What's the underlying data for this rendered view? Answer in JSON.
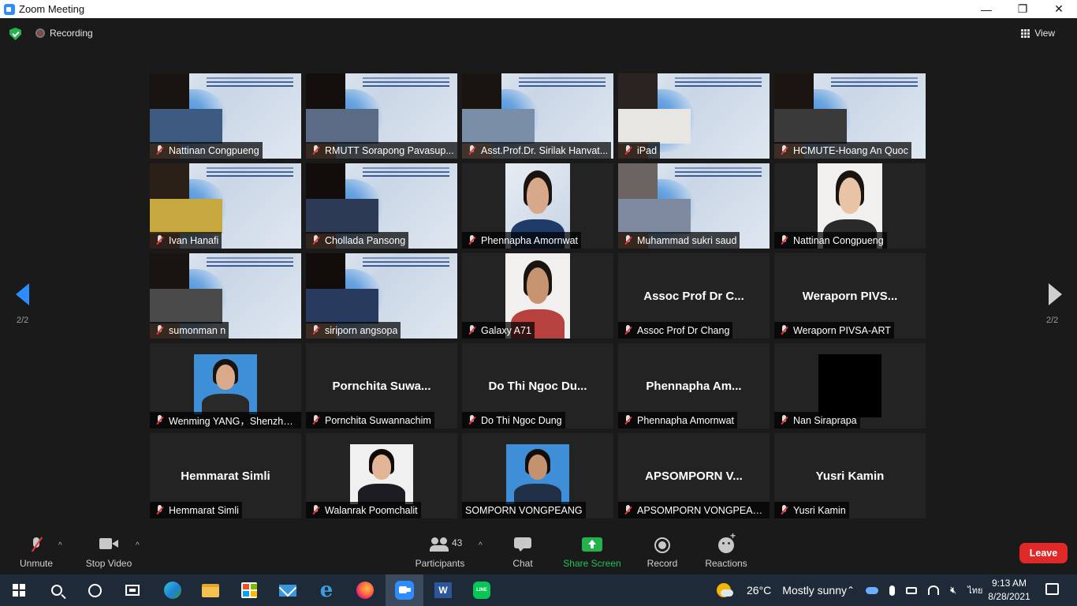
{
  "window": {
    "title": "Zoom Meeting",
    "minimize_glyph": "—",
    "maximize_glyph": "❐",
    "close_glyph": "✕"
  },
  "meeting": {
    "recording_label": "Recording",
    "view_label": "View",
    "page_indicator_left": "2/2",
    "page_indicator_right": "2/2"
  },
  "tiles": [
    {
      "label": "Nattinan Congpueng",
      "muted": true,
      "kind": "banner",
      "person": {
        "skin": "#c99a78",
        "hair": "#1a1410",
        "shirt": "#3d5a80"
      }
    },
    {
      "label": "RMUTT Sorapong Pavasup...",
      "muted": true,
      "kind": "banner",
      "person": {
        "skin": "#c9956f",
        "hair": "#140f0c",
        "shirt": "#5b6b86"
      }
    },
    {
      "label": "Asst.Prof.Dr. Sirilak Hanvat...",
      "muted": true,
      "kind": "banner",
      "person": {
        "skin": "#e5b89a",
        "hair": "#1a1410",
        "shirt": "#7a8ea8"
      }
    },
    {
      "label": "iPad",
      "muted": true,
      "kind": "banner",
      "person": {
        "skin": "#c79573",
        "hair": "#2a2320",
        "shirt": "#e8e6e2"
      }
    },
    {
      "label": "HCMUTE-Hoang An Quoc",
      "muted": true,
      "kind": "banner",
      "person": {
        "skin": "#d6a685",
        "hair": "#1c1410",
        "shirt": "#3b3a3a"
      }
    },
    {
      "label": "Ivan Hanafi",
      "muted": true,
      "kind": "banner",
      "person": {
        "skin": "#a8755a",
        "hair": "#2a2018",
        "shirt": "#c7a83e"
      }
    },
    {
      "label": "Chollada Pansong",
      "muted": true,
      "kind": "banner",
      "person": {
        "skin": "#b88466",
        "hair": "#120d0a",
        "shirt": "#2c3a55"
      }
    },
    {
      "label": "Phennapha Amornwat",
      "muted": true,
      "kind": "narrow-banner",
      "person": {
        "skin": "#d8a88a",
        "hair": "#1a1410",
        "shirt": "#1f3c68"
      }
    },
    {
      "label": "Muhammad sukri saud",
      "muted": true,
      "kind": "banner",
      "person": {
        "skin": "#c08b6d",
        "hair": "#6b6460",
        "shirt": "#7d8aa0"
      }
    },
    {
      "label": "Nattinan Congpueng",
      "muted": true,
      "kind": "portrait-white",
      "person": {
        "skin": "#e8c3a6",
        "hair": "#1a1410",
        "shirt": "#2a2a2a"
      }
    },
    {
      "label": "sumonman n",
      "muted": true,
      "kind": "banner",
      "person": {
        "skin": "#c38f70",
        "hair": "#1a1410",
        "shirt": "#4a4a4a"
      }
    },
    {
      "label": "siriporn angsopa",
      "muted": true,
      "kind": "banner",
      "person": {
        "skin": "#d3a283",
        "hair": "#120d0a",
        "shirt": "#283a5e"
      }
    },
    {
      "label": "Galaxy A71",
      "muted": true,
      "kind": "portrait-white",
      "person": {
        "skin": "#c79472",
        "hair": "#1a1410",
        "shirt": "#b7413f"
      }
    },
    {
      "label": "Assoc Prof Dr Chang",
      "muted": true,
      "kind": "name",
      "big_name": "Assoc Prof Dr C..."
    },
    {
      "label": "Weraporn PIVSA-ART",
      "muted": true,
      "kind": "name",
      "big_name": "Weraporn  PIVS..."
    },
    {
      "label": "Wenming YANG，Shenzhen...",
      "muted": true,
      "kind": "photo-blue",
      "person": {
        "skin": "#d9a98a",
        "hair": "#1a1410",
        "shirt": "#2a2a2a"
      }
    },
    {
      "label": "Pornchita Suwannachim",
      "muted": true,
      "kind": "name",
      "big_name": "Pornchita  Suwa..."
    },
    {
      "label": "Do Thi Ngoc Dung",
      "muted": true,
      "kind": "name",
      "big_name": "Do Thi Ngoc Du..."
    },
    {
      "label": "Phennapha Amornwat",
      "muted": true,
      "kind": "name",
      "big_name": "Phennapha  Am..."
    },
    {
      "label": "Nan Siraprapa",
      "muted": true,
      "kind": "black"
    },
    {
      "label": "Hemmarat Simli",
      "muted": true,
      "kind": "name",
      "big_name": "Hemmarat Simli"
    },
    {
      "label": "Walanrak Poomchalit",
      "muted": true,
      "kind": "photo-white",
      "person": {
        "skin": "#e2b596",
        "hair": "#0f0b09",
        "shirt": "#1c1c22"
      }
    },
    {
      "label": "SOMPORN VONGPEANG",
      "muted": false,
      "kind": "photo-blue",
      "person": {
        "skin": "#c4926f",
        "hair": "#120d0a",
        "shirt": "#223047"
      }
    },
    {
      "label": "APSOMPORN VONGPEANG",
      "muted": true,
      "kind": "name",
      "big_name": "APSOMPORN  V..."
    },
    {
      "label": "Yusri Kamin",
      "muted": true,
      "kind": "name",
      "big_name": "Yusri Kamin"
    }
  ],
  "toolbar": {
    "unmute_label": "Unmute",
    "stop_video_label": "Stop Video",
    "participants_label": "Participants",
    "participants_count": "43",
    "chat_label": "Chat",
    "share_label": "Share Screen",
    "record_label": "Record",
    "reactions_label": "Reactions",
    "leave_label": "Leave",
    "caret_glyph": "^"
  },
  "taskbar": {
    "weather_temp": "26°C",
    "weather_text": "Mostly sunny",
    "language": "ไทย",
    "time": "9:13 AM",
    "date": "8/28/2021",
    "ie_glyph": "e",
    "word_glyph": "W",
    "line_glyph": "LINE"
  },
  "colors": {
    "zoom_blue": "#2d8cff",
    "leave_red": "#e02828",
    "share_green": "#23b24c",
    "tile_bg": "#232323"
  }
}
